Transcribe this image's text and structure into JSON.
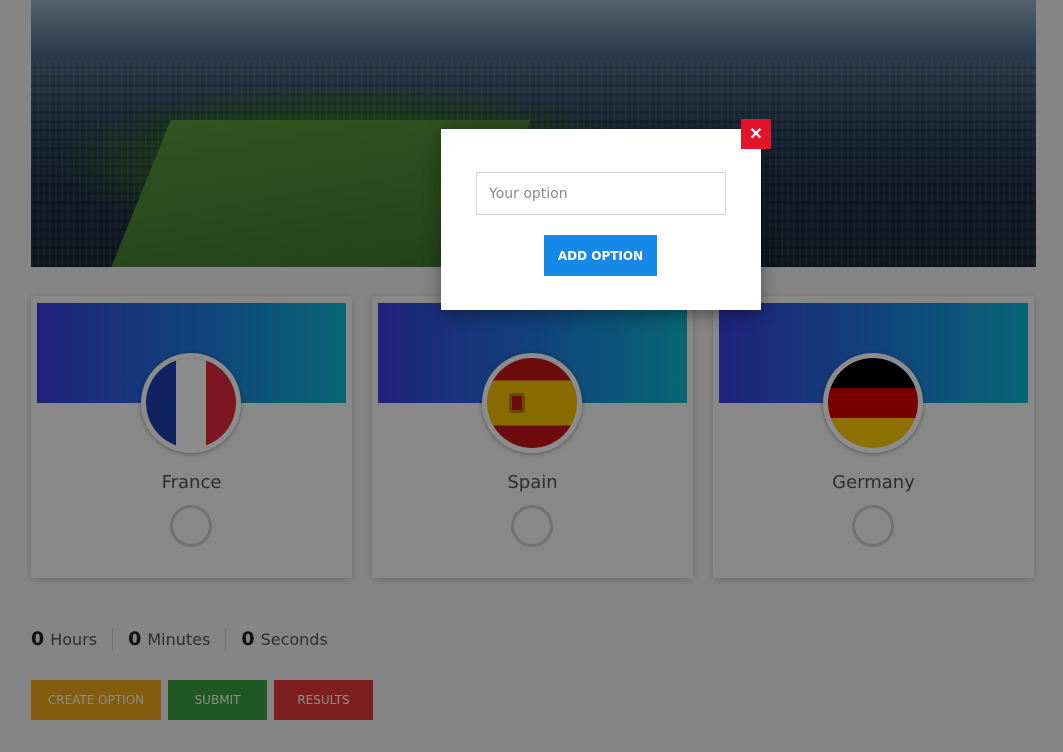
{
  "hero": {
    "icon": "stadium-photo"
  },
  "options": [
    {
      "name": "France",
      "flag": "france-flag",
      "colors": [
        "#1f3fb0",
        "#ffffff",
        "#e3293b"
      ]
    },
    {
      "name": "Spain",
      "flag": "spain-flag",
      "colors": [
        "#c8151b",
        "#f6c400",
        "#c8151b"
      ]
    },
    {
      "name": "Germany",
      "flag": "germany-flag",
      "colors": [
        "#000000",
        "#dd0000",
        "#ffce00"
      ]
    }
  ],
  "timer": {
    "hours": {
      "value": "0",
      "label": "Hours"
    },
    "minutes": {
      "value": "0",
      "label": "Minutes"
    },
    "seconds": {
      "value": "0",
      "label": "Seconds"
    }
  },
  "actions": {
    "create_label": "CREATE OPTION",
    "submit_label": "SUBMIT",
    "results_label": "RESULTS"
  },
  "modal": {
    "input_placeholder": "Your option",
    "input_value": "",
    "add_label": "ADD OPTION",
    "close_icon": "✕"
  },
  "colors": {
    "create": "#f0a81c",
    "submit": "#3aa13e",
    "results": "#e53a3a",
    "add": "#1688e8",
    "close": "#e3142a"
  }
}
